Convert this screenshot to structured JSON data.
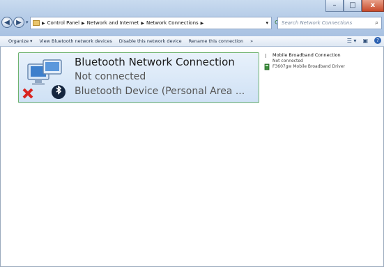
{
  "window": {
    "caption": {
      "minimize": "–",
      "maximize": "□",
      "close": "x"
    }
  },
  "nav": {
    "back": "◀",
    "forward": "▶",
    "dropdown": "▾"
  },
  "address": {
    "crumbs": [
      "Control Panel",
      "Network and Internet",
      "Network Connections"
    ],
    "separator": "▶",
    "dropdown": "▾",
    "refresh": "⟳"
  },
  "search": {
    "placeholder": "Search Network Connections",
    "icon": "⌕"
  },
  "toolbar": {
    "organize": "Organize ▾",
    "view_bluetooth": "View Bluetooth network devices",
    "disable": "Disable this network device",
    "rename": "Rename this connection",
    "more": "»",
    "views": "☰ ▾",
    "pane": "▣",
    "help": "?"
  },
  "connections": [
    {
      "name": "Bluetooth Network Connection",
      "status": "Not connected",
      "device": "Bluetooth Device (Personal Area ..."
    },
    {
      "name": "Mobile Broadband Connection",
      "status": "Not connected",
      "device": "F3607gw Mobile Broadband Driver"
    }
  ],
  "colors": {
    "selection_border": "#6fb36f",
    "selection_fill": "#cfe1f5",
    "titlebar": "#b7cde8"
  }
}
